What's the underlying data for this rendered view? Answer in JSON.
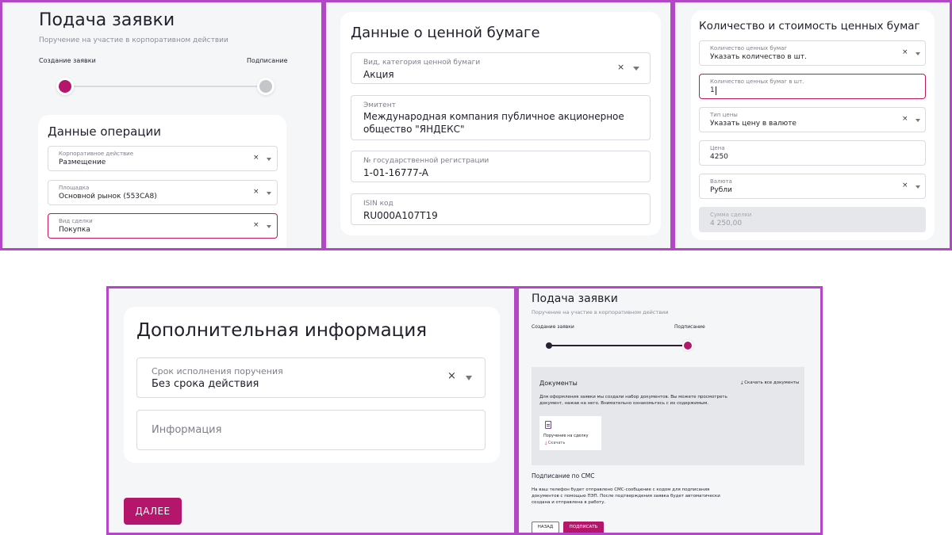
{
  "p1": {
    "title": "Подача заявки",
    "subtitle": "Поручение на участие в корпоративном действии",
    "step1": "Создание заявки",
    "step2": "Подписание",
    "section": "Данные операции",
    "fields": [
      {
        "label": "Корпоративное действие",
        "value": "Размещение"
      },
      {
        "label": "Площадка",
        "value": "Основной рынок (553CA8)"
      },
      {
        "label": "Вид сделки",
        "value": "Покупка"
      }
    ]
  },
  "p2": {
    "title": "Данные о ценной бумаге",
    "fields": [
      {
        "label": "Вид, категория ценной бумаги",
        "value": "Акция"
      },
      {
        "label": "Эмитент",
        "value_line1": "Международная компания публичное акционерное",
        "value_line2": "общество \"ЯНДЕКС\""
      },
      {
        "label": "№ государственной регистрации",
        "value": "1-01-16777-A"
      },
      {
        "label": "ISIN код",
        "value": "RU000A107T19"
      }
    ]
  },
  "p3": {
    "title": "Количество и стоимость ценных бумаг",
    "fields": [
      {
        "label": "Количество ценных бумаг",
        "value": "Указать количество в шт."
      },
      {
        "label": "Количество ценных бумаг в шт.",
        "value": "1"
      },
      {
        "label": "Тип цены",
        "value": "Указать цену в валюте"
      },
      {
        "label": "Цена",
        "value": "4250"
      },
      {
        "label": "Валюта",
        "value": "Рубли"
      },
      {
        "label": "Сумма сделки",
        "value": "4 250,00"
      }
    ]
  },
  "p4": {
    "title": "Дополнительная информация",
    "fields": [
      {
        "label": "Срок исполнения поручения",
        "value": "Без срока действия"
      },
      {
        "placeholder": "Информация"
      }
    ],
    "next_button": "ДАЛЕЕ"
  },
  "p5": {
    "title": "Подача заявки",
    "subtitle": "Поручение на участие в корпоративном действии",
    "step1": "Создание заявки",
    "step2": "Подписание",
    "docs_title": "Документы",
    "download_all": "Скачать все документы",
    "docs_text_line1": "Для оформления заявки мы создали набор документов. Вы можете просмотреть",
    "docs_text_line2": "документ, нажав на него. Внимательно ознакомьтесь с их содержимым.",
    "doc_name": "Поручение на сделку",
    "doc_download": "Скачать",
    "sms_title": "Подписание по СМС",
    "sms_text_line1": "На ваш телефон будет отправлено СМС-сообщение с кодом для подписания",
    "sms_text_line2": "документов с помощью ПЭП. После подтверждения заявка будет автоматически",
    "sms_text_line3": "создана и отправлена в работу.",
    "back_button": "НАЗАД",
    "sign_button": "ПОДПИСАТЬ"
  },
  "colors": {
    "frame": "#b347c7",
    "accent": "#b5166b",
    "background": "#f5f6f8"
  },
  "icons": [
    "clear-x-icon",
    "chevron-down-icon",
    "download-icon",
    "document-icon"
  ]
}
